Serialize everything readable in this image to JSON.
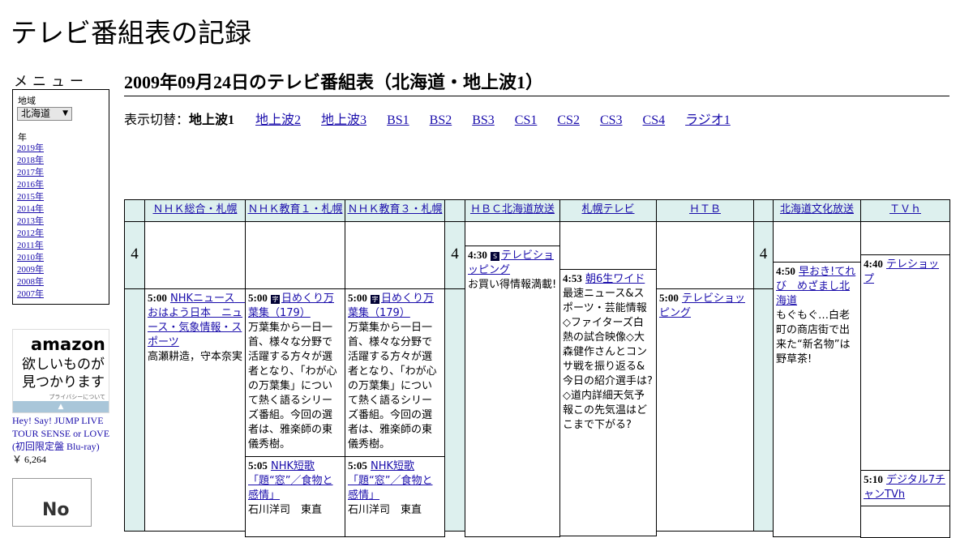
{
  "site": {
    "title": "テレビ番組表の記録"
  },
  "menu": {
    "title": "メニュー",
    "region_label": "地域",
    "region_value": "北海道",
    "year_label": "年",
    "years": [
      "2019年",
      "2018年",
      "2017年",
      "2016年",
      "2015年",
      "2014年",
      "2013年",
      "2012年",
      "2011年",
      "2010年",
      "2009年",
      "2008年",
      "2007年"
    ]
  },
  "ad": {
    "logo": "amazon",
    "tagline_1": "欲しいものが",
    "tagline_2": "見つかります",
    "privacy": "プライバシーについて",
    "product_title": "Hey! Say! JUMP LIVE TOUR SENSE or LOVE (初回限定盤 Blu-ray)",
    "product_price": "￥ 6,264",
    "noimage": "No"
  },
  "heading": "2009年09月24日のテレビ番組表（北海道・地上波1）",
  "switcher": {
    "prefix": "表示切替：",
    "current": "地上波1",
    "links": [
      "地上波2",
      "地上波3",
      "BS1",
      "BS2",
      "BS3",
      "CS1",
      "CS2",
      "CS3",
      "CS4",
      "ラジオ1"
    ]
  },
  "channels": [
    "ＮＨＫ総合・札幌",
    "ＮＨＫ教育１・札幌",
    "ＮＨＫ教育３・札幌",
    "ＨＢＣ北海道放送",
    "札幌テレビ",
    "ＨＴＢ",
    "北海道文化放送",
    "ＴＶｈ"
  ],
  "hour": "4",
  "programs": {
    "nhk_sogo": {
      "time": "5:00",
      "title": "NHKニュース　おはよう日本　ニュース・気象情報・スポーツ",
      "desc": "高瀬耕造，守本奈実"
    },
    "edu1_a": {
      "time": "5:00",
      "badge": "字",
      "title": "日めくり万葉集（179）",
      "desc": "万葉集から一日一首、様々な分野で活躍する方々が選者となり、「わが心の万葉集」について熱く語るシリーズ番組。今回の選者は、雅楽師の東儀秀樹。"
    },
    "edu1_b": {
      "time": "5:05",
      "title": "NHK短歌「題“窓”／食物と感情」",
      "desc": "石川洋司　東直"
    },
    "edu3_a": {
      "time": "5:00",
      "badge": "字",
      "title": "日めくり万葉集（179）",
      "desc": "万葉集から一日一首、様々な分野で活躍する方々が選者となり、「わが心の万葉集」について熱く語るシリーズ番組。今回の選者は、雅楽師の東儀秀樹。"
    },
    "edu3_b": {
      "time": "5:05",
      "title": "NHK短歌「題“窓”／食物と感情」",
      "desc": "石川洋司　東直"
    },
    "hbc": {
      "time": "4:30",
      "badge": "S",
      "title": "テレビショッピング",
      "desc": "お買い得情報満載!"
    },
    "stv": {
      "time": "4:53",
      "title": "朝6生ワイド",
      "desc": "最速ニュース&スポーツ・芸能情報◇ファイターズ白熱の試合映像◇大森健作さんとコンサ戦を振り返る&今日の紹介選手は?◇道内詳細天気予報この先気温はどこまで下がる?"
    },
    "htb": {
      "time": "5:00",
      "title": "テレビショッピング"
    },
    "uhb": {
      "time": "4:50",
      "title": "早おき!てれび　めざまし北海道",
      "desc": "もぐもぐ…白老町の商店街で出来た“新名物”は野草茶!"
    },
    "tvh_a": {
      "time": "4:40",
      "title": "テレショップ"
    },
    "tvh_b": {
      "time": "5:10",
      "title": "デジタル7チャンTVh"
    }
  }
}
